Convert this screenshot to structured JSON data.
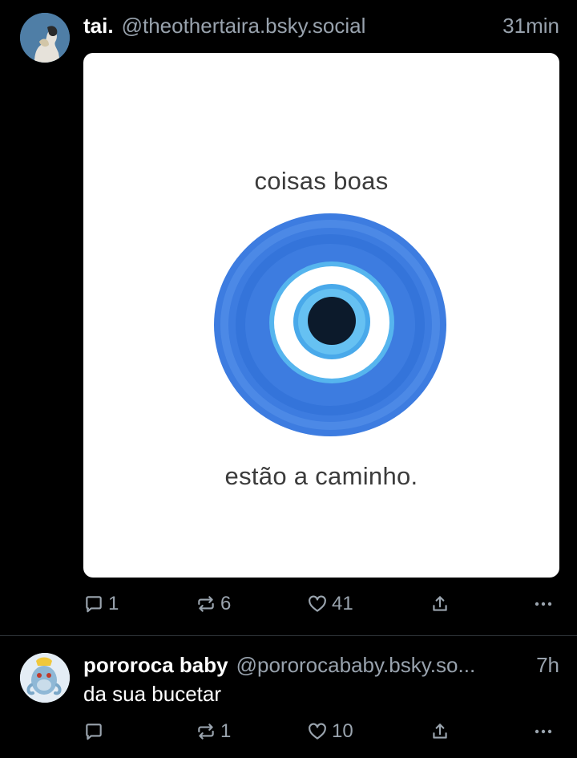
{
  "posts": [
    {
      "author_name": "tai.",
      "author_handle": "@theothertaira.bsky.social",
      "time": "31min",
      "image": {
        "caption_top": "coisas boas",
        "caption_bottom": "estão a caminho."
      },
      "counts": {
        "replies": "1",
        "reposts": "6",
        "likes": "41"
      }
    },
    {
      "author_name": "pororoca baby",
      "author_handle": "@pororocababy.bsky.so...",
      "time": "7h",
      "text": "da sua bucetar",
      "counts": {
        "replies": "",
        "reposts": "1",
        "likes": "10"
      }
    }
  ],
  "icons": {
    "reply": "speech-bubble-icon",
    "repost": "repost-arrows-icon",
    "like": "heart-icon",
    "share": "share-upload-icon",
    "more": "ellipsis-icon"
  },
  "colors": {
    "background": "#000000",
    "muted_text": "#98a2ad",
    "divider": "#2e3338",
    "evil_eye_outer": "#3f7de0",
    "evil_eye_light": "#4fb2ec",
    "evil_eye_pupil": "#0b1a2a"
  }
}
